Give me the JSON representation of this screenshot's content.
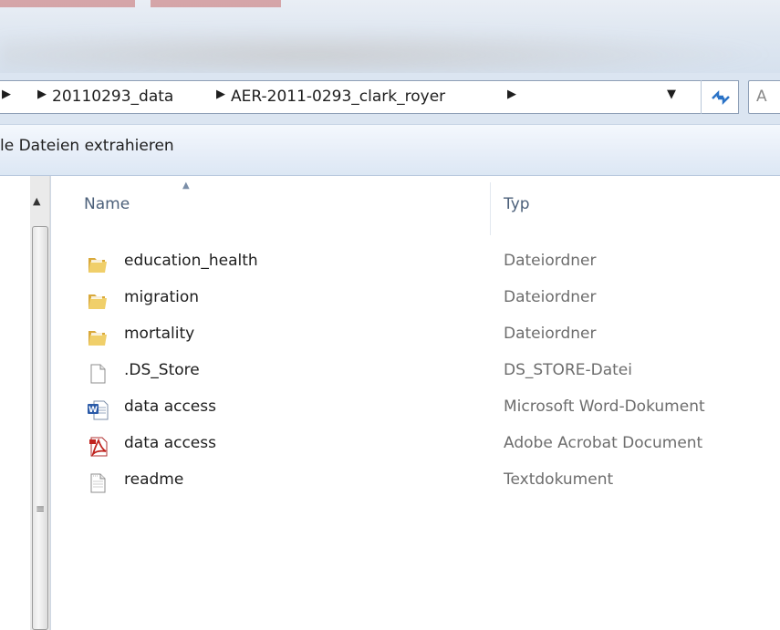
{
  "breadcrumb": {
    "items": [
      "20110293_data",
      "AER-2011-0293_clark_royer"
    ]
  },
  "search": {
    "visible_text": "A"
  },
  "toolbar": {
    "extract_label": "le Dateien extrahieren"
  },
  "columns": {
    "name": "Name",
    "type": "Typ"
  },
  "files": [
    {
      "name": "education_health",
      "type": "Dateiordner",
      "icon": "folder-icon"
    },
    {
      "name": "migration",
      "type": "Dateiordner",
      "icon": "folder-icon"
    },
    {
      "name": "mortality",
      "type": "Dateiordner",
      "icon": "folder-icon"
    },
    {
      "name": ".DS_Store",
      "type": "DS_STORE-Datei",
      "icon": "blank-file-icon"
    },
    {
      "name": "data access",
      "type": "Microsoft Word-Dokument",
      "icon": "word-document-icon"
    },
    {
      "name": "data access",
      "type": "Adobe Acrobat Document",
      "icon": "pdf-document-icon"
    },
    {
      "name": "readme",
      "type": "Textdokument",
      "icon": "text-file-icon"
    }
  ],
  "colors": {
    "accent_blue": "#2b73c7",
    "folder_yellow": "#e8c15a",
    "pdf_red": "#c0241f",
    "word_blue": "#2a5aa8"
  }
}
